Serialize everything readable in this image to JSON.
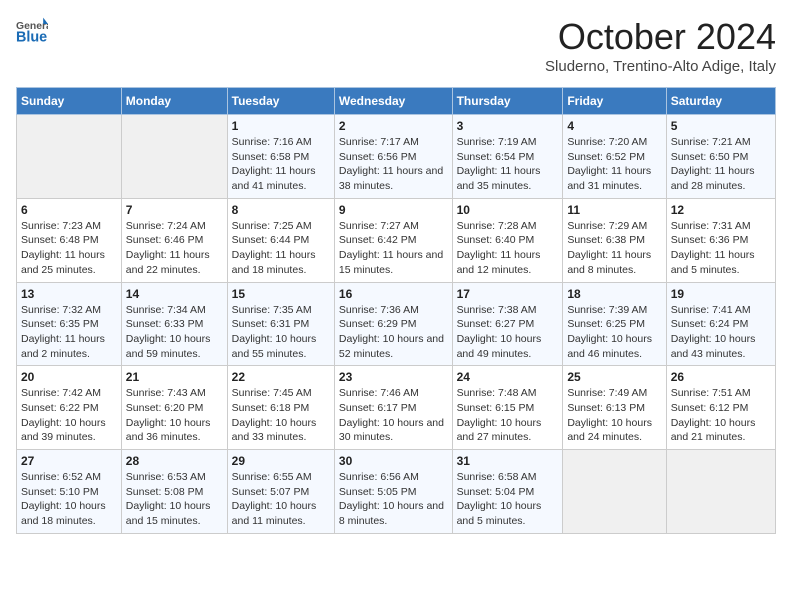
{
  "header": {
    "logo_general": "General",
    "logo_blue": "Blue",
    "month_title": "October 2024",
    "location": "Sluderno, Trentino-Alto Adige, Italy"
  },
  "days_of_week": [
    "Sunday",
    "Monday",
    "Tuesday",
    "Wednesday",
    "Thursday",
    "Friday",
    "Saturday"
  ],
  "weeks": [
    [
      {
        "day": "",
        "info": ""
      },
      {
        "day": "",
        "info": ""
      },
      {
        "day": "1",
        "info": "Sunrise: 7:16 AM\nSunset: 6:58 PM\nDaylight: 11 hours and 41 minutes."
      },
      {
        "day": "2",
        "info": "Sunrise: 7:17 AM\nSunset: 6:56 PM\nDaylight: 11 hours and 38 minutes."
      },
      {
        "day": "3",
        "info": "Sunrise: 7:19 AM\nSunset: 6:54 PM\nDaylight: 11 hours and 35 minutes."
      },
      {
        "day": "4",
        "info": "Sunrise: 7:20 AM\nSunset: 6:52 PM\nDaylight: 11 hours and 31 minutes."
      },
      {
        "day": "5",
        "info": "Sunrise: 7:21 AM\nSunset: 6:50 PM\nDaylight: 11 hours and 28 minutes."
      }
    ],
    [
      {
        "day": "6",
        "info": "Sunrise: 7:23 AM\nSunset: 6:48 PM\nDaylight: 11 hours and 25 minutes."
      },
      {
        "day": "7",
        "info": "Sunrise: 7:24 AM\nSunset: 6:46 PM\nDaylight: 11 hours and 22 minutes."
      },
      {
        "day": "8",
        "info": "Sunrise: 7:25 AM\nSunset: 6:44 PM\nDaylight: 11 hours and 18 minutes."
      },
      {
        "day": "9",
        "info": "Sunrise: 7:27 AM\nSunset: 6:42 PM\nDaylight: 11 hours and 15 minutes."
      },
      {
        "day": "10",
        "info": "Sunrise: 7:28 AM\nSunset: 6:40 PM\nDaylight: 11 hours and 12 minutes."
      },
      {
        "day": "11",
        "info": "Sunrise: 7:29 AM\nSunset: 6:38 PM\nDaylight: 11 hours and 8 minutes."
      },
      {
        "day": "12",
        "info": "Sunrise: 7:31 AM\nSunset: 6:36 PM\nDaylight: 11 hours and 5 minutes."
      }
    ],
    [
      {
        "day": "13",
        "info": "Sunrise: 7:32 AM\nSunset: 6:35 PM\nDaylight: 11 hours and 2 minutes."
      },
      {
        "day": "14",
        "info": "Sunrise: 7:34 AM\nSunset: 6:33 PM\nDaylight: 10 hours and 59 minutes."
      },
      {
        "day": "15",
        "info": "Sunrise: 7:35 AM\nSunset: 6:31 PM\nDaylight: 10 hours and 55 minutes."
      },
      {
        "day": "16",
        "info": "Sunrise: 7:36 AM\nSunset: 6:29 PM\nDaylight: 10 hours and 52 minutes."
      },
      {
        "day": "17",
        "info": "Sunrise: 7:38 AM\nSunset: 6:27 PM\nDaylight: 10 hours and 49 minutes."
      },
      {
        "day": "18",
        "info": "Sunrise: 7:39 AM\nSunset: 6:25 PM\nDaylight: 10 hours and 46 minutes."
      },
      {
        "day": "19",
        "info": "Sunrise: 7:41 AM\nSunset: 6:24 PM\nDaylight: 10 hours and 43 minutes."
      }
    ],
    [
      {
        "day": "20",
        "info": "Sunrise: 7:42 AM\nSunset: 6:22 PM\nDaylight: 10 hours and 39 minutes."
      },
      {
        "day": "21",
        "info": "Sunrise: 7:43 AM\nSunset: 6:20 PM\nDaylight: 10 hours and 36 minutes."
      },
      {
        "day": "22",
        "info": "Sunrise: 7:45 AM\nSunset: 6:18 PM\nDaylight: 10 hours and 33 minutes."
      },
      {
        "day": "23",
        "info": "Sunrise: 7:46 AM\nSunset: 6:17 PM\nDaylight: 10 hours and 30 minutes."
      },
      {
        "day": "24",
        "info": "Sunrise: 7:48 AM\nSunset: 6:15 PM\nDaylight: 10 hours and 27 minutes."
      },
      {
        "day": "25",
        "info": "Sunrise: 7:49 AM\nSunset: 6:13 PM\nDaylight: 10 hours and 24 minutes."
      },
      {
        "day": "26",
        "info": "Sunrise: 7:51 AM\nSunset: 6:12 PM\nDaylight: 10 hours and 21 minutes."
      }
    ],
    [
      {
        "day": "27",
        "info": "Sunrise: 6:52 AM\nSunset: 5:10 PM\nDaylight: 10 hours and 18 minutes."
      },
      {
        "day": "28",
        "info": "Sunrise: 6:53 AM\nSunset: 5:08 PM\nDaylight: 10 hours and 15 minutes."
      },
      {
        "day": "29",
        "info": "Sunrise: 6:55 AM\nSunset: 5:07 PM\nDaylight: 10 hours and 11 minutes."
      },
      {
        "day": "30",
        "info": "Sunrise: 6:56 AM\nSunset: 5:05 PM\nDaylight: 10 hours and 8 minutes."
      },
      {
        "day": "31",
        "info": "Sunrise: 6:58 AM\nSunset: 5:04 PM\nDaylight: 10 hours and 5 minutes."
      },
      {
        "day": "",
        "info": ""
      },
      {
        "day": "",
        "info": ""
      }
    ]
  ]
}
